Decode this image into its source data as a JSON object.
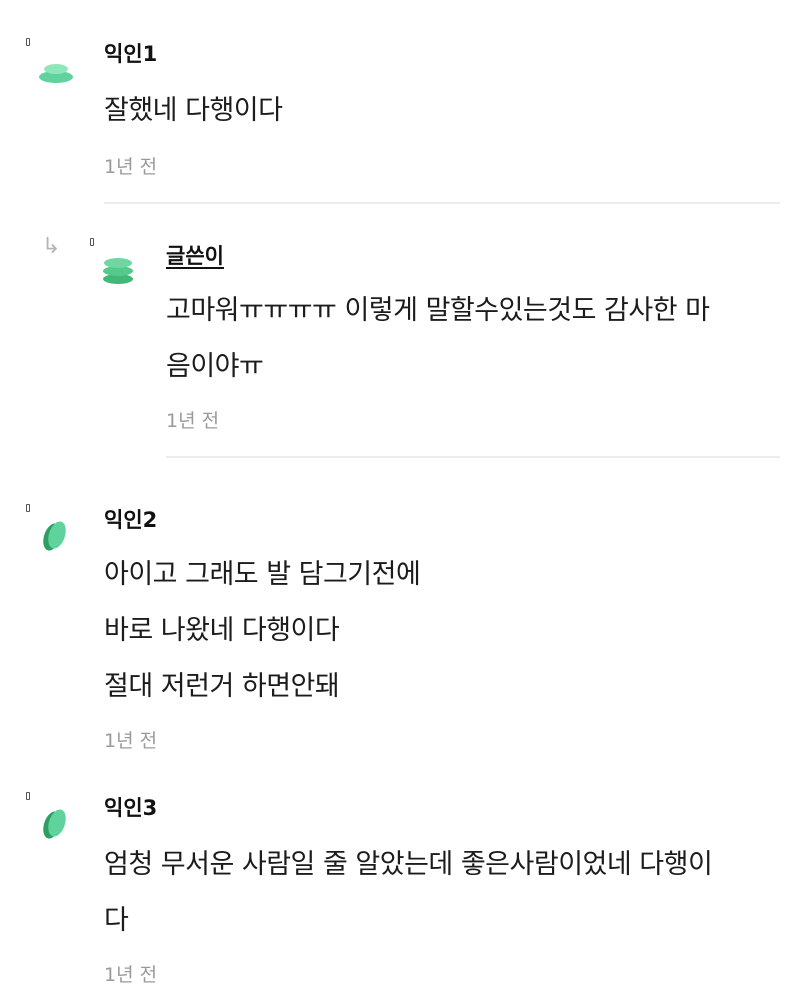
{
  "colors": {
    "avatar_green": "#5fd39b",
    "avatar_green_dark": "#2f9e64",
    "text_primary": "#1c1c1c",
    "text_time": "#9a9a9a",
    "divider": "#ececec"
  },
  "comments": [
    {
      "author": "익인1",
      "lines": [
        "잘했네 다행이다"
      ],
      "time": "1년 전"
    },
    {
      "author": "글쓴이",
      "is_reply": true,
      "reply_icon": "reply-arrow-icon",
      "lines": [
        "고마워ㅠㅠㅠㅠ 이렇게 말할수있는것도 감사한 마",
        "음이야ㅠ"
      ],
      "time": "1년 전"
    },
    {
      "author": "익인2",
      "lines": [
        "아이고 그래도 발 담그기전에",
        "바로 나왔네 다행이다",
        "절대 저런거 하면안돼"
      ],
      "time": "1년 전"
    },
    {
      "author": "익인3",
      "lines": [
        "엄청 무서운 사람일 줄 알았는데 좋은사람이었네 다행이",
        "다"
      ],
      "time": "1년 전"
    }
  ]
}
